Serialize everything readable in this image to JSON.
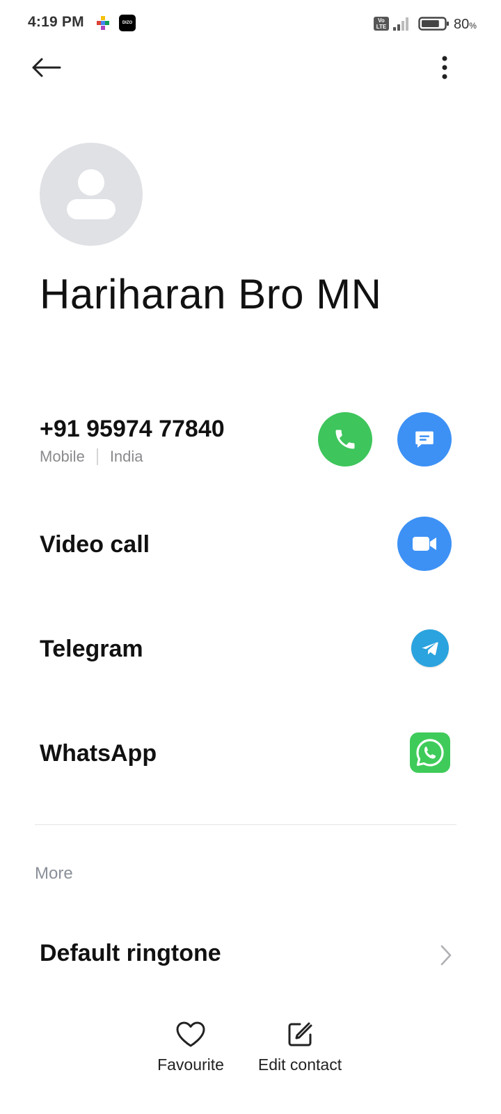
{
  "status_bar": {
    "time": "4:19 PM",
    "app_icons": [
      "colorful-app-icon",
      "dizo-icon"
    ],
    "dizo_text": "DIZO",
    "volte_text": "Vo\nLTE",
    "battery_percent": "80",
    "battery_unit": "%",
    "battery_level": 0.8
  },
  "top_bar": {
    "back_icon": "arrow-left-icon",
    "more_icon": "more-vertical-icon"
  },
  "contact": {
    "name": "Hariharan Bro MN",
    "avatar_icon": "person-placeholder-icon"
  },
  "phone": {
    "number": "+91 95974 77840",
    "type": "Mobile",
    "country": "India",
    "call_icon": "phone-icon",
    "message_icon": "message-icon"
  },
  "rows": {
    "video_call": "Video call",
    "telegram": "Telegram",
    "whatsapp": "WhatsApp"
  },
  "more_section": {
    "title": "More",
    "ringtone_label": "Default ringtone"
  },
  "bottom_actions": {
    "favourite": "Favourite",
    "edit_contact": "Edit contact"
  },
  "colors": {
    "call_green": "#3ec55c",
    "action_blue": "#3d91f5",
    "telegram_blue": "#2aa3de",
    "whatsapp_green": "#3fcb5a"
  }
}
